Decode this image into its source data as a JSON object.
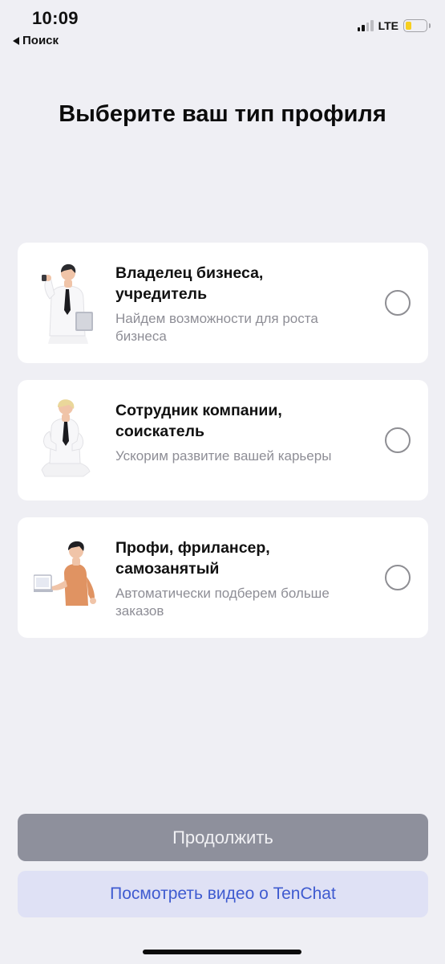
{
  "status_bar": {
    "time": "10:09",
    "back_label": "Поиск",
    "network": "LTE",
    "signal_bars_on": 2,
    "signal_bars_total": 4,
    "battery_level": 0.3,
    "battery_color": "#f7cf20"
  },
  "title": "Выберите ваш тип профиля",
  "options": [
    {
      "title": "Владелец бизнеса, учредитель",
      "subtitle": "Найдем возможности для роста бизнеса",
      "illustration": "business-owner-icon",
      "selected": false
    },
    {
      "title": "Сотрудник компании, соискатель",
      "subtitle": "Ускорим развитие вашей карьеры",
      "illustration": "employee-icon",
      "selected": false
    },
    {
      "title": "Профи, фрилансер, самозанятый",
      "subtitle": "Автоматически подберем больше заказов",
      "illustration": "freelancer-icon",
      "selected": false
    }
  ],
  "buttons": {
    "continue": "Продолжить",
    "video": "Посмотреть видео о TenChat"
  },
  "colors": {
    "background": "#efeff4",
    "continue_bg": "#8e909c",
    "video_bg": "#dfe1f5",
    "video_text": "#3f5bd0"
  }
}
